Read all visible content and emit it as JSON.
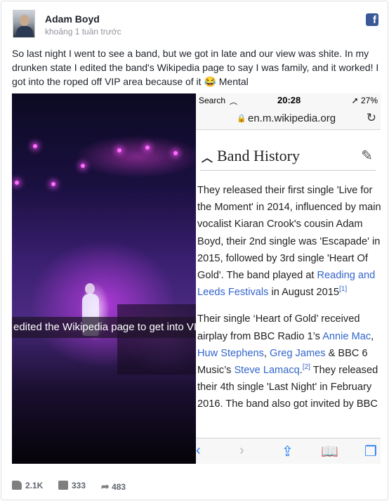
{
  "post": {
    "author": "Adam Boyd",
    "timestamp": "khoảng 1 tuần trước",
    "text": "So last night I went to see a band, but we got in late and our view was shite. In my drunken state I edited the band's Wikipedia page to say I was family, and it worked! I got into the roped off VIP area because of it 😂 Mental",
    "platform_icon": "facebook-icon"
  },
  "photo": {
    "caption": "edited the Wikipedia page to get into VIP"
  },
  "phone": {
    "status": {
      "carrier": "Search",
      "signal": "•••••",
      "time": "20:28",
      "battery": "➚ 27%"
    },
    "url": "en.m.wikipedia.org",
    "section_title": "Band History",
    "para1": {
      "t1": "They released their first single 'Live for the Moment' in 2014, influenced by main vocalist Kiaran Crook's cousin Adam Boyd, their 2nd single was 'Escapade' in 2015, followed by 3rd single 'Heart Of Gold'. The band played at ",
      "link1": "Reading and Leeds Festivals",
      "t2": " in August 2015",
      "ref": "[1]"
    },
    "para2": {
      "t1": "Their single ‘Heart of Gold’ received airplay from BBC Radio 1’s ",
      "link1": "Annie Mac",
      "t2": ", ",
      "link2": "Huw Stephens",
      "t3": ", ",
      "link3": "Greg James",
      "t4": " & BBC 6 Music’s ",
      "link4": "Steve Lamacq",
      "t5": ".",
      "ref": "[2]",
      "t6": " They released their 4th single 'Last Night' in February 2016. The band also got invited by BBC"
    }
  },
  "footer": {
    "likes": "2.1K",
    "comments": "333",
    "shares": "483"
  },
  "colors": {
    "link": "#3366cc",
    "facebook": "#3b5998",
    "ios_blue": "#1e7cf2"
  }
}
